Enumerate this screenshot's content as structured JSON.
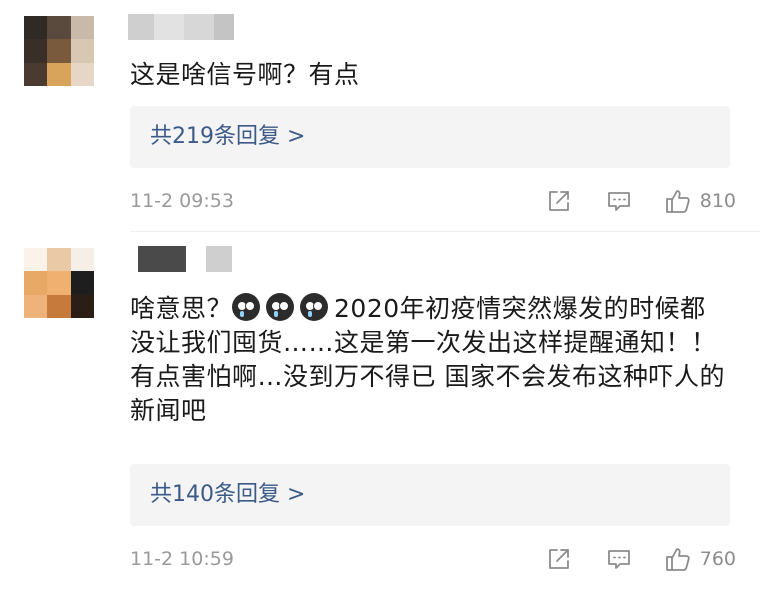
{
  "comments": [
    {
      "text": "这是啥信号啊？有点",
      "replies_label": "共219条回复 >",
      "time": "11-2 09:53",
      "likes": "810"
    },
    {
      "text_before": "啥意思？",
      "text_after": "2020年初疫情突然爆发的时候都没让我们囤货……这是第一次发出这样提醒通知！！有点害怕啊…没到万不得已 国家不会发布这种吓人的新闻吧",
      "replies_label": "共140条回复 >",
      "time": "11-2 10:59",
      "likes": "760"
    }
  ],
  "icons": {
    "share": "share-icon",
    "comment": "comment-icon",
    "like": "thumbs-up-icon",
    "emoji": "crying-emoji-icon"
  },
  "colors": {
    "reply_link": "#3c5a88",
    "meta_text": "#9a9a9a",
    "reply_bg": "#f4f4f4"
  }
}
